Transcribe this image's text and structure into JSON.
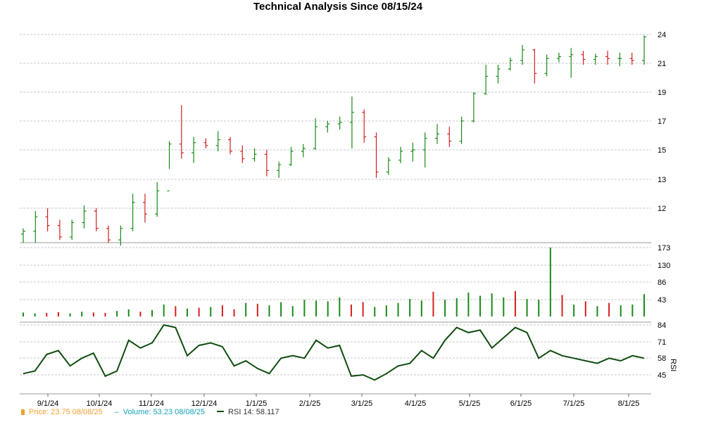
{
  "title": "Technical Analysis Since 08/15/24",
  "colors": {
    "up": "#1a8a1a",
    "down": "#d32020",
    "rsi_line": "#0f4d0f",
    "grid": "#b5b5b5",
    "price_legend": "#f0a030",
    "volume_legend": "#17a2b8"
  },
  "legend": {
    "price": "Price: 23.75  08/08/25",
    "volume": "Volume: 53.23  08/08/25",
    "rsi": "RSI 14: 58.117"
  },
  "chart_data": {
    "type": "stock-technical",
    "x_labels": [
      "9/1/24",
      "10/1/24",
      "11/1/24",
      "12/1/24",
      "1/1/25",
      "2/1/25",
      "3/1/25",
      "4/1/25",
      "5/1/25",
      "6/1/25",
      "7/1/25",
      "8/1/25"
    ],
    "price": {
      "ticks": [
        "24",
        "21",
        "19",
        "17",
        "15",
        "13",
        "12"
      ],
      "values": [
        24,
        21,
        19,
        17,
        15,
        13,
        12
      ],
      "ohlc": [
        {
          "date": "8/15/24",
          "o": 11.1,
          "h": 11.3,
          "l": 10.8,
          "c": 11.2
        },
        {
          "date": "8/22/24",
          "o": 11.2,
          "h": 11.9,
          "l": 10.8,
          "c": 11.7
        },
        {
          "date": "8/29/24",
          "o": 11.7,
          "h": 12.0,
          "l": 11.2,
          "c": 11.4
        },
        {
          "date": "9/5/24",
          "o": 11.4,
          "h": 11.6,
          "l": 10.9,
          "c": 11.0
        },
        {
          "date": "9/12/24",
          "o": 11.0,
          "h": 11.6,
          "l": 10.9,
          "c": 11.5
        },
        {
          "date": "9/19/24",
          "o": 11.5,
          "h": 12.1,
          "l": 11.3,
          "c": 11.9
        },
        {
          "date": "9/26/24",
          "o": 11.9,
          "h": 12.0,
          "l": 11.2,
          "c": 11.3
        },
        {
          "date": "10/3/24",
          "o": 11.3,
          "h": 11.4,
          "l": 10.8,
          "c": 10.9
        },
        {
          "date": "10/10/24",
          "o": 10.9,
          "h": 11.4,
          "l": 10.7,
          "c": 11.3
        },
        {
          "date": "10/17/24",
          "o": 11.3,
          "h": 12.5,
          "l": 11.2,
          "c": 12.2
        },
        {
          "date": "10/24/24",
          "o": 12.2,
          "h": 12.5,
          "l": 11.5,
          "c": 11.8
        },
        {
          "date": "10/31/24",
          "o": 11.8,
          "h": 12.9,
          "l": 11.7,
          "c": 12.6
        },
        {
          "date": "11/7/24",
          "o": 12.6,
          "h": 15.6,
          "l": 13.7,
          "c": 15.4
        },
        {
          "date": "11/14/24",
          "o": 15.4,
          "h": 18.1,
          "l": 14.4,
          "c": 14.8
        },
        {
          "date": "11/21/24",
          "o": 14.8,
          "h": 15.9,
          "l": 14.1,
          "c": 15.5
        },
        {
          "date": "11/28/24",
          "o": 15.5,
          "h": 15.8,
          "l": 15.1,
          "c": 15.3
        },
        {
          "date": "12/5/24",
          "o": 15.3,
          "h": 16.3,
          "l": 14.9,
          "c": 15.7
        },
        {
          "date": "12/12/24",
          "o": 15.7,
          "h": 15.9,
          "l": 14.7,
          "c": 14.9
        },
        {
          "date": "12/19/24",
          "o": 14.9,
          "h": 15.3,
          "l": 14.1,
          "c": 14.4
        },
        {
          "date": "12/26/24",
          "o": 14.4,
          "h": 15.1,
          "l": 14.2,
          "c": 14.7
        },
        {
          "date": "1/2/25",
          "o": 14.7,
          "h": 15.0,
          "l": 13.2,
          "c": 13.6
        },
        {
          "date": "1/9/25",
          "o": 13.6,
          "h": 14.2,
          "l": 13.1,
          "c": 14.0
        },
        {
          "date": "1/16/25",
          "o": 14.0,
          "h": 15.2,
          "l": 13.9,
          "c": 14.9
        },
        {
          "date": "1/23/25",
          "o": 14.9,
          "h": 15.4,
          "l": 14.5,
          "c": 15.1
        },
        {
          "date": "1/30/25",
          "o": 15.1,
          "h": 17.2,
          "l": 15.0,
          "c": 16.6
        },
        {
          "date": "2/6/25",
          "o": 16.6,
          "h": 17.0,
          "l": 16.2,
          "c": 16.8
        },
        {
          "date": "2/13/25",
          "o": 16.8,
          "h": 17.3,
          "l": 16.4,
          "c": 16.9
        },
        {
          "date": "2/20/25",
          "o": 16.9,
          "h": 18.7,
          "l": 15.1,
          "c": 17.6
        },
        {
          "date": "2/27/25",
          "o": 17.6,
          "h": 17.8,
          "l": 15.5,
          "c": 15.9
        },
        {
          "date": "3/6/25",
          "o": 15.9,
          "h": 16.2,
          "l": 13.1,
          "c": 13.5
        },
        {
          "date": "3/13/25",
          "o": 13.5,
          "h": 14.5,
          "l": 13.3,
          "c": 14.3
        },
        {
          "date": "3/20/25",
          "o": 14.3,
          "h": 15.2,
          "l": 14.1,
          "c": 14.9
        },
        {
          "date": "3/27/25",
          "o": 14.9,
          "h": 15.5,
          "l": 14.2,
          "c": 15.0
        },
        {
          "date": "4/3/25",
          "o": 15.0,
          "h": 16.2,
          "l": 13.8,
          "c": 15.8
        },
        {
          "date": "4/10/25",
          "o": 15.8,
          "h": 16.8,
          "l": 15.4,
          "c": 16.1
        },
        {
          "date": "4/17/25",
          "o": 16.1,
          "h": 16.6,
          "l": 15.2,
          "c": 15.6
        },
        {
          "date": "4/24/25",
          "o": 15.6,
          "h": 17.3,
          "l": 15.4,
          "c": 17.0
        },
        {
          "date": "5/1/25",
          "o": 17.0,
          "h": 19.0,
          "l": 16.9,
          "c": 18.9
        },
        {
          "date": "5/8/25",
          "o": 18.9,
          "h": 20.9,
          "l": 18.8,
          "c": 20.1
        },
        {
          "date": "5/15/25",
          "o": 20.1,
          "h": 20.9,
          "l": 19.6,
          "c": 20.6
        },
        {
          "date": "5/22/25",
          "o": 20.6,
          "h": 21.6,
          "l": 20.5,
          "c": 21.3
        },
        {
          "date": "5/29/25",
          "o": 21.3,
          "h": 22.9,
          "l": 20.9,
          "c": 22.4
        },
        {
          "date": "6/5/25",
          "o": 22.4,
          "h": 22.5,
          "l": 19.6,
          "c": 20.3
        },
        {
          "date": "6/12/25",
          "o": 20.3,
          "h": 21.9,
          "l": 20.1,
          "c": 21.5
        },
        {
          "date": "6/19/25",
          "o": 21.5,
          "h": 22.1,
          "l": 21.1,
          "c": 21.7
        },
        {
          "date": "6/26/25",
          "o": 21.7,
          "h": 22.6,
          "l": 20.0,
          "c": 21.9
        },
        {
          "date": "7/3/25",
          "o": 21.9,
          "h": 22.3,
          "l": 20.9,
          "c": 21.4
        },
        {
          "date": "7/10/25",
          "o": 21.4,
          "h": 22.0,
          "l": 20.9,
          "c": 21.7
        },
        {
          "date": "7/17/25",
          "o": 21.7,
          "h": 22.3,
          "l": 20.9,
          "c": 21.5
        },
        {
          "date": "7/24/25",
          "o": 21.5,
          "h": 22.1,
          "l": 20.8,
          "c": 21.5
        },
        {
          "date": "7/31/25",
          "o": 21.5,
          "h": 22.1,
          "l": 20.9,
          "c": 21.3
        },
        {
          "date": "8/8/25",
          "o": 21.3,
          "h": 23.9,
          "l": 20.9,
          "c": 23.75
        }
      ]
    },
    "volume": {
      "ticks": [
        "173",
        "130",
        "86",
        "43"
      ],
      "values": [
        173,
        130,
        86,
        43
      ],
      "bars": [
        10,
        8,
        9,
        11,
        8,
        12,
        10,
        9,
        14,
        18,
        12,
        16,
        30,
        26,
        20,
        22,
        24,
        28,
        18,
        34,
        32,
        28,
        36,
        26,
        42,
        40,
        38,
        48,
        30,
        36,
        24,
        28,
        34,
        44,
        40,
        62,
        42,
        46,
        60,
        52,
        58,
        48,
        64,
        44,
        42,
        173,
        54,
        30,
        38,
        26,
        34,
        28,
        30,
        56
      ]
    },
    "rsi": {
      "ticks": [
        "84",
        "71",
        "58",
        "45"
      ],
      "values": [
        84,
        71,
        58,
        45
      ],
      "points": [
        46,
        48,
        61,
        64,
        52,
        58,
        62,
        44,
        48,
        72,
        66,
        70,
        84,
        82,
        60,
        68,
        70,
        67,
        52,
        56,
        50,
        46,
        58,
        60,
        58,
        72,
        66,
        68,
        44,
        45,
        41,
        46,
        52,
        54,
        64,
        58,
        72,
        82,
        78,
        80,
        66,
        74,
        82,
        78,
        58,
        64,
        60,
        58,
        56,
        54,
        58,
        56,
        60,
        58
      ]
    }
  }
}
